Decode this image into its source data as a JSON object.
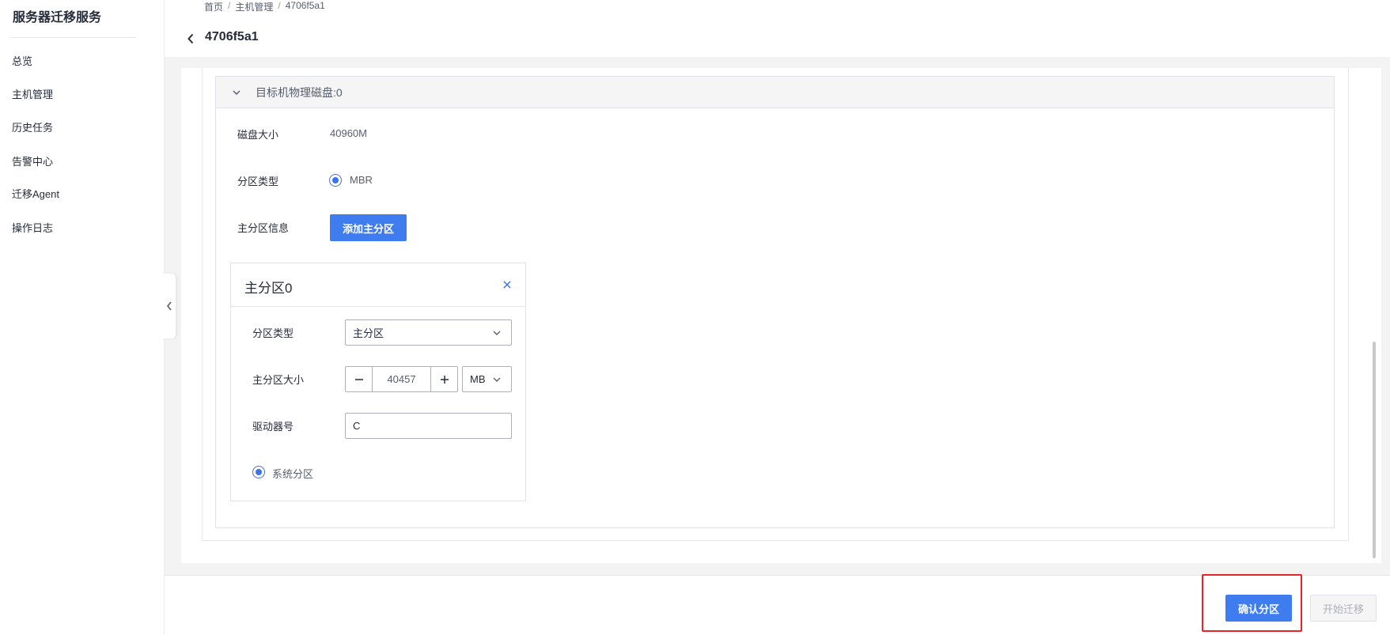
{
  "app": {
    "title": "服务器迁移服务"
  },
  "sidebar": {
    "items": [
      {
        "label": "总览"
      },
      {
        "label": "主机管理"
      },
      {
        "label": "历史任务"
      },
      {
        "label": "告警中心"
      },
      {
        "label": "迁移Agent"
      },
      {
        "label": "操作日志"
      }
    ]
  },
  "header": {
    "breadcrumb": [
      "首页",
      "主机管理",
      "4706f5a1"
    ],
    "breadcrumb_sep": "/",
    "title": "4706f5a1"
  },
  "disk": {
    "section_title": "目标机物理磁盘:0",
    "size_label": "磁盘大小",
    "size_value": "40960M",
    "partition_type_label": "分区类型",
    "partition_type_value": "MBR",
    "primary_info_label": "主分区信息",
    "add_primary_button": "添加主分区"
  },
  "partition": {
    "title": "主分区0",
    "type_label": "分区类型",
    "type_value": "主分区",
    "size_label": "主分区大小",
    "size_value": "40457",
    "size_unit": "MB",
    "drive_label": "驱动器号",
    "drive_value": "C",
    "system_partition_label": "系统分区"
  },
  "footer": {
    "confirm_button": "确认分区",
    "start_button": "开始迁移"
  },
  "colors": {
    "primary": "#3f7cf0",
    "highlight": "#e8232a",
    "radio": "#3a74e8"
  }
}
